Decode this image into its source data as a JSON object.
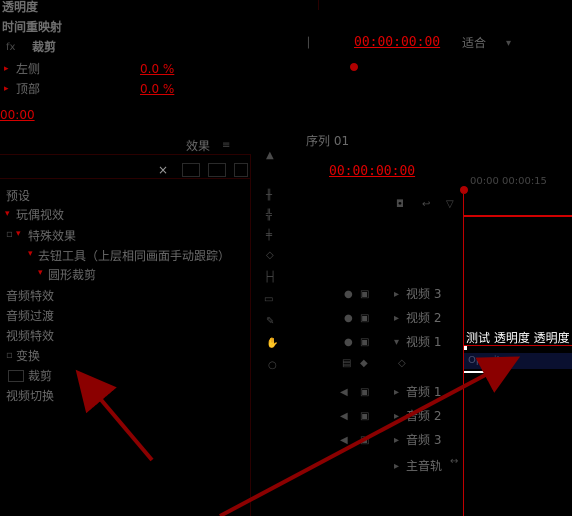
{
  "effect_controls": {
    "opacity": "透明度",
    "time_remap": "时间重映射",
    "crop_effect": "裁剪",
    "left_label": "左侧",
    "left_value": "0.0 %",
    "top_label": "顶部",
    "top_value": "0.0 %",
    "timecode": "00:00"
  },
  "program_monitor": {
    "timecode": "00:00:00:00",
    "fit_label": "适合"
  },
  "effects_panel": {
    "tab_label": "效果",
    "close_symbol": "×",
    "tree": [
      {
        "label": "预设"
      },
      {
        "label": "玩偶视效"
      },
      {
        "label": "特殊效果"
      },
      {
        "label": "去钮工具（上层相同画面手动跟踪）"
      },
      {
        "label": "圆形裁剪"
      },
      {
        "label": "音频特效"
      },
      {
        "label": "音频过渡"
      },
      {
        "label": "视频特效"
      },
      {
        "label": "变换"
      },
      {
        "label": "裁剪"
      },
      {
        "label": "视频切换"
      }
    ]
  },
  "sequence": {
    "tab_label": "序列 01",
    "timecode": "00:00:00:00",
    "ruler_text": "00:00    00:00:15",
    "tracks": {
      "video3": "视频 3",
      "video2": "视频 2",
      "video1": "视频 1",
      "audio1": "音频 1",
      "audio2": "音频 2",
      "audio3": "音频 3",
      "master": "主音轨"
    },
    "clip_title": "测试 透明度 透明度",
    "clip_label": "Opacity"
  },
  "colors": {
    "accent_red": "#e00000",
    "annotation_arrow": "#8b0000",
    "clip_bg": "#0a1030"
  }
}
